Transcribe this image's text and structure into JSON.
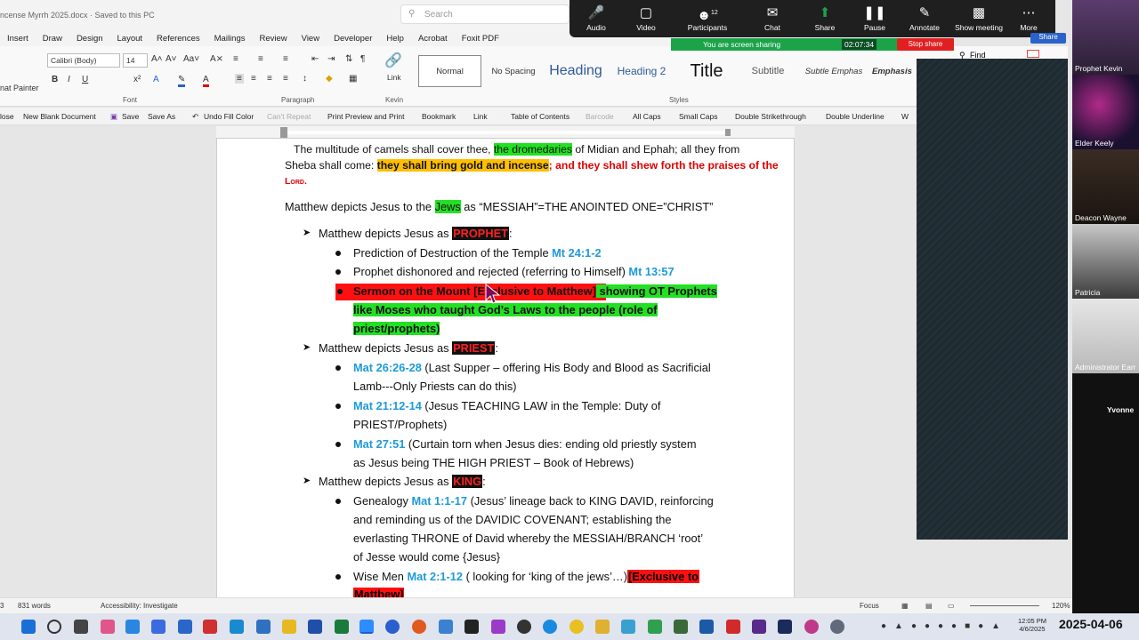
{
  "titlebar": {
    "doc_name": "ncense Myrrh 2025.docx  ·  Saved to this PC",
    "search_placeholder": "Search"
  },
  "tabs": [
    "Insert",
    "Draw",
    "Design",
    "Layout",
    "References",
    "Mailings",
    "Review",
    "View",
    "Developer",
    "Help",
    "Acrobat",
    "Foxit PDF"
  ],
  "ribbon": {
    "font_name": "Calibri (Body)",
    "font_size": "14",
    "format_painter": "nat Painter",
    "group_font": "Font",
    "group_paragraph": "Paragraph",
    "group_kevin": "Kevin",
    "group_styles": "Styles",
    "link_label": "Link",
    "styles": [
      "Normal",
      "No Spacing",
      "Heading",
      "Heading 2",
      "Title",
      "Subtitle",
      "Subtle Emphas",
      "Emphasis"
    ],
    "find": "Find"
  },
  "qbar": [
    "lose",
    "New Blank Document",
    "Save",
    "Save As",
    "Undo Fill Color",
    "Can't Repeat",
    "Print Preview and Print",
    "Bookmark",
    "Link",
    "Table of Contents",
    "Barcode",
    "All Caps",
    "Small Caps",
    "Double Strikethrough",
    "Double Underline",
    "W"
  ],
  "doc": {
    "l1a": "The multitude of camels shall cover thee, ",
    "l1b": "the dromedaries",
    "l1c": " of Midian and Ephah; all they from",
    "l2a": "Sheba shall come: ",
    "l2b": "they shall bring gold and incense",
    "l2c": "; and they shall shew forth the praises of the",
    "l3": "Lord.",
    "h1a": "Matthew depicts Jesus to the ",
    "h1b": "Jews",
    "h1c": " as “MESSIAH”=THE ANOINTED ONE=”CHRIST”",
    "p_head": "Matthew depicts Jesus as ",
    "p_tag": "PROPHET",
    "p_b1a": "Prediction of Destruction of the Temple ",
    "p_b1b": "Mt 24:1-2",
    "p_b2a": "Prophet dishonored and rejected (referring to Himself) ",
    "p_b2b": "Mt 13:57",
    "p_b3a": "Sermon on the Mount [Exclusive to Matthew]",
    "p_b3b": " showing OT Prophets",
    "p_b3c": "like Moses who taught God’s Laws to the people (role of",
    "p_b3d": "priest/prophets)",
    "pr_head": "Matthew depicts Jesus as ",
    "pr_tag": "PRIEST",
    "pr_b1a": "Mat 26:26-28",
    "pr_b1b": " (Last Supper – offering His Body and Blood as Sacrificial",
    "pr_b1c": "Lamb---Only Priests can do this)",
    "pr_b2a": "Mat 21:12-14",
    "pr_b2b": " (Jesus TEACHING LAW in the Temple: Duty of",
    "pr_b2c": "PRIEST/Prophets)",
    "pr_b3a": "Mat 27:51",
    "pr_b3b": " (Curtain torn when Jesus dies: ending old priestly system",
    "pr_b3c": "as Jesus being THE HIGH PRIEST – Book of Hebrews)",
    "k_head": "Matthew depicts Jesus as ",
    "k_tag": "KING",
    "k_b1a": "Genealogy ",
    "k_b1b": "Mat 1:1-17",
    "k_b1c": " (Jesus’ lineage back to KING DAVID, reinforcing",
    "k_b1d": "and reminding us of the DAVIDIC COVENANT; establishing the",
    "k_b1e": "everlasting THRONE of David whereby the MESSIAH/BRANCH ‘root’",
    "k_b1f": "of Jesse would come {Jesus}",
    "k_b2a": "Wise Men ",
    "k_b2b": "Mat 2:1-12",
    "k_b2c": " ( looking for ‘king of the jews’…)",
    "k_b2d": "[Exclusive to",
    "k_b2e": "Matthew]"
  },
  "zoom": {
    "items": [
      {
        "icon": "microphone-icon",
        "label": "Audio"
      },
      {
        "icon": "camera-icon",
        "label": "Video"
      },
      {
        "icon": "participants-icon",
        "label": "Participants",
        "count": "12"
      },
      {
        "icon": "chat-icon",
        "label": "Chat"
      },
      {
        "icon": "share-icon",
        "label": "Share"
      },
      {
        "icon": "pause-icon",
        "label": "Pause"
      },
      {
        "icon": "annotate-icon",
        "label": "Annotate"
      },
      {
        "icon": "show-meeting-icon",
        "label": "Show meeting"
      },
      {
        "icon": "more-icon",
        "label": "More"
      }
    ],
    "sharing_text": "You are screen sharing",
    "timer": "02:07:34",
    "stop_share": "Stop share",
    "share_btn": "Share"
  },
  "participants": [
    "Prophet Kevin",
    "Elder Keely",
    "Deacon Wayne",
    "Patricia",
    "Administrator Earr",
    "Yvonne"
  ],
  "status": {
    "page": "3",
    "words": "831 words",
    "accessibility": "Accessibility: Investigate",
    "focus": "Focus",
    "zoom": "120%"
  },
  "taskbar": {
    "time": "12:05 PM",
    "date_small": "4/6/2025",
    "date_big": "2025-04-06"
  },
  "colors": {
    "highlight_green": "#22e022",
    "highlight_yellow": "#ffbf00",
    "scripture_blue": "#1e9ad8",
    "accent_red": "#e00000",
    "zoom_green": "#1ca34a"
  }
}
